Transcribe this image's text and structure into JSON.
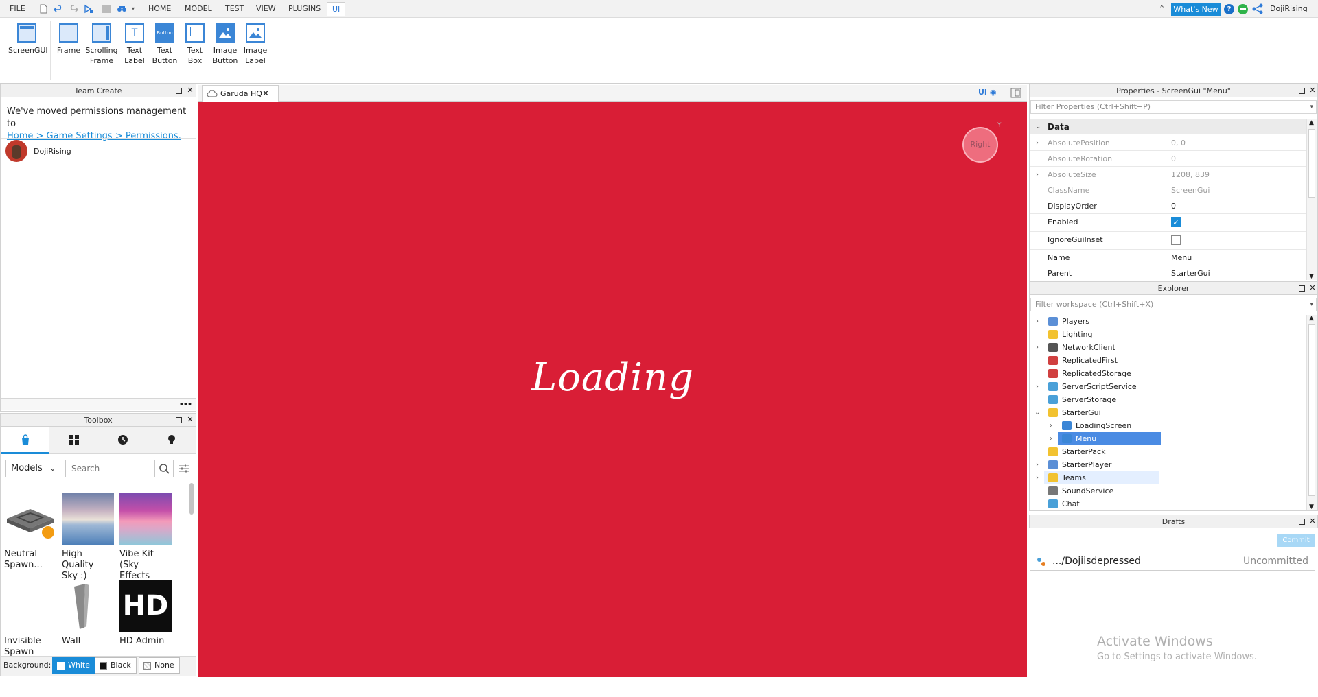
{
  "menu": {
    "file": "FILE",
    "tabs": [
      "HOME",
      "MODEL",
      "TEST",
      "VIEW",
      "PLUGINS",
      "UI"
    ],
    "active_tab": "UI",
    "whats_new": "What's New",
    "username": "DojiRising"
  },
  "ribbon": {
    "tools": [
      {
        "line1": "ScreenGUI",
        "line2": ""
      },
      {
        "line1": "Frame",
        "line2": ""
      },
      {
        "line1": "Scrolling",
        "line2": "Frame"
      },
      {
        "line1": "Text",
        "line2": "Label"
      },
      {
        "line1": "Text",
        "line2": "Button"
      },
      {
        "line1": "Text",
        "line2": "Box"
      },
      {
        "line1": "Image",
        "line2": "Button"
      },
      {
        "line1": "Image",
        "line2": "Label"
      }
    ],
    "button_icon_text": "Button"
  },
  "team_create": {
    "title": "Team Create",
    "message": "We've moved permissions management to",
    "link": "Home > Game Settings > Permissions.",
    "user": "DojiRising",
    "more": "•••"
  },
  "toolbox": {
    "title": "Toolbox",
    "category": "Models",
    "search_placeholder": "Search",
    "assets": [
      {
        "line1": "Neutral",
        "line2": "Spawn..."
      },
      {
        "line1": "High Quality",
        "line2": "Sky :)"
      },
      {
        "line1": "Vibe Kit (Sky",
        "line2": "Effects Only)"
      },
      {
        "line1": "Invisible",
        "line2": "Spawn"
      },
      {
        "line1": "Wall",
        "line2": ""
      },
      {
        "line1": "HD Admin",
        "line2": ""
      }
    ],
    "hd_logo": "HD",
    "background_label": "Background:",
    "bg_options": [
      "White",
      "Black",
      "None"
    ],
    "bg_active": "White"
  },
  "viewport": {
    "tab_name": "Garuda HQ",
    "ui_toggle": "UI",
    "loading_text": "Loading",
    "orient_label": "Right",
    "orient_axis": "Y",
    "bg_color": "#d91e36"
  },
  "properties": {
    "title": "Properties - ScreenGui \"Menu\"",
    "filter_placeholder": "Filter Properties (Ctrl+Shift+P)",
    "category": "Data",
    "rows": [
      {
        "name": "AbsolutePosition",
        "value": "0, 0",
        "readonly": true,
        "expand": true
      },
      {
        "name": "AbsoluteRotation",
        "value": "0",
        "readonly": true,
        "expand": false
      },
      {
        "name": "AbsoluteSize",
        "value": "1208, 839",
        "readonly": true,
        "expand": true
      },
      {
        "name": "ClassName",
        "value": "ScreenGui",
        "readonly": true,
        "expand": false
      },
      {
        "name": "DisplayOrder",
        "value": "0",
        "readonly": false,
        "expand": false
      },
      {
        "name": "Enabled",
        "value": "",
        "readonly": false,
        "expand": false,
        "checkbox": true,
        "checked": true
      },
      {
        "name": "IgnoreGuiInset",
        "value": "",
        "readonly": false,
        "expand": false,
        "checkbox": true,
        "checked": false
      },
      {
        "name": "Name",
        "value": "Menu",
        "readonly": false,
        "expand": false
      },
      {
        "name": "Parent",
        "value": "StarterGui",
        "readonly": false,
        "expand": false
      }
    ]
  },
  "explorer": {
    "title": "Explorer",
    "filter_placeholder": "Filter workspace (Ctrl+Shift+X)",
    "items": [
      {
        "label": "Players",
        "depth": 0,
        "expand": "closed",
        "color": "#5b8fd6"
      },
      {
        "label": "Lighting",
        "depth": 0,
        "expand": "none",
        "color": "#f2c230"
      },
      {
        "label": "NetworkClient",
        "depth": 0,
        "expand": "closed",
        "color": "#555555"
      },
      {
        "label": "ReplicatedFirst",
        "depth": 0,
        "expand": "none",
        "color": "#d04040"
      },
      {
        "label": "ReplicatedStorage",
        "depth": 0,
        "expand": "none",
        "color": "#d04040"
      },
      {
        "label": "ServerScriptService",
        "depth": 0,
        "expand": "closed",
        "color": "#4aa0d8"
      },
      {
        "label": "ServerStorage",
        "depth": 0,
        "expand": "none",
        "color": "#4aa0d8"
      },
      {
        "label": "StarterGui",
        "depth": 0,
        "expand": "open",
        "color": "#f2c230"
      },
      {
        "label": "LoadingScreen",
        "depth": 1,
        "expand": "closed",
        "color": "#3b86d6"
      },
      {
        "label": "Menu",
        "depth": 1,
        "expand": "closed",
        "color": "#3b86d6",
        "selected": true
      },
      {
        "label": "StarterPack",
        "depth": 0,
        "expand": "none",
        "color": "#f2c230"
      },
      {
        "label": "StarterPlayer",
        "depth": 0,
        "expand": "closed",
        "color": "#5b8fd6"
      },
      {
        "label": "Teams",
        "depth": 0,
        "expand": "closed",
        "color": "#f2c230",
        "hover": true
      },
      {
        "label": "SoundService",
        "depth": 0,
        "expand": "none",
        "color": "#777777"
      },
      {
        "label": "Chat",
        "depth": 0,
        "expand": "none",
        "color": "#4aa0d8"
      }
    ]
  },
  "drafts": {
    "title": "Drafts",
    "commit": "Commit",
    "file": ".../Dojiisdepressed",
    "status": "Uncommitted"
  },
  "windows_watermark": {
    "line1": "Activate Windows",
    "line2": "Go to Settings to activate Windows."
  }
}
